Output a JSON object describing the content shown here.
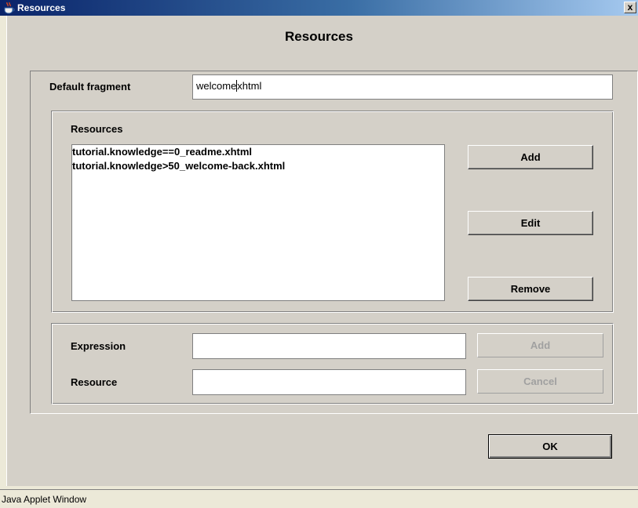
{
  "window": {
    "title": "Resources",
    "close_glyph": "x",
    "icon": "java-coffee-icon"
  },
  "dialog": {
    "heading": "Resources"
  },
  "default_fragment": {
    "label": "Default fragment",
    "value_before_caret": "welcome",
    "value_after_caret": "xhtml"
  },
  "resources": {
    "label": "Resources",
    "items": [
      "tutorial.knowledge==0_readme.xhtml",
      "tutorial.knowledge>50_welcome-back.xhtml"
    ],
    "add_label": "Add",
    "edit_label": "Edit",
    "remove_label": "Remove"
  },
  "editor": {
    "expression_label": "Expression",
    "expression_value": "",
    "resource_label": "Resource",
    "resource_value": "",
    "add_label": "Add",
    "cancel_label": "Cancel"
  },
  "ok_label": "OK",
  "status": {
    "text": "Java Applet Window"
  },
  "colors": {
    "title_bar": "#0a246a",
    "panel": "#d4d0c8",
    "desktop": "#ece9d8"
  }
}
